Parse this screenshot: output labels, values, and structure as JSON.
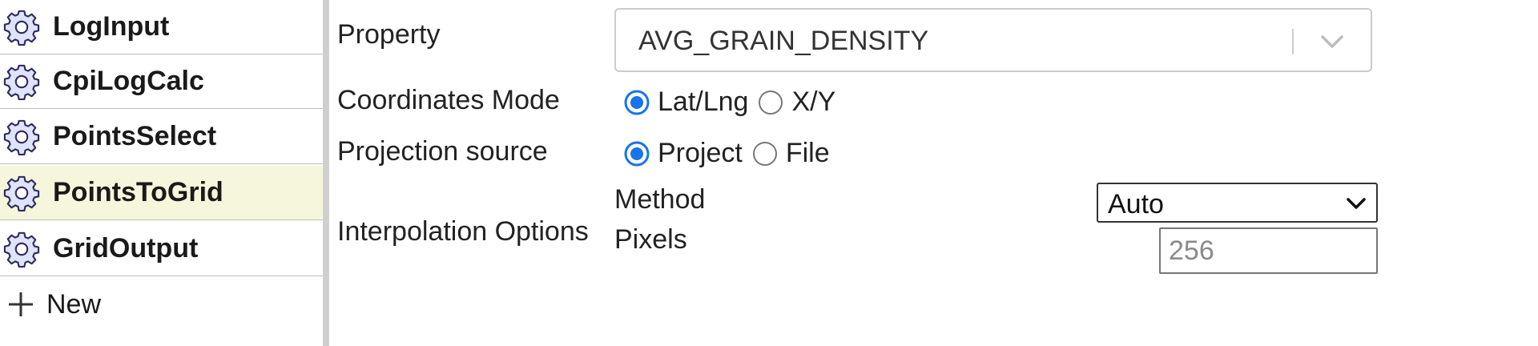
{
  "sidebar": {
    "steps": [
      {
        "label": "LogInput",
        "icon": "gear-icon",
        "active": false
      },
      {
        "label": "CpiLogCalc",
        "icon": "gear-icon",
        "active": false
      },
      {
        "label": "PointsSelect",
        "icon": "gear-icon",
        "active": false
      },
      {
        "label": "PointsToGrid",
        "icon": "gear-icon",
        "active": true
      },
      {
        "label": "GridOutput",
        "icon": "gear-icon",
        "active": false
      }
    ],
    "new_item": {
      "label": "New",
      "icon": "plus-icon"
    },
    "active_background": "#f6f6dc"
  },
  "form": {
    "property": {
      "label": "Property",
      "selected_value": "AVG_GRAIN_DENSITY",
      "icon": "chevron-down-icon"
    },
    "coordinates_mode": {
      "label": "Coordinates Mode",
      "options": [
        {
          "label": "Lat/Lng",
          "checked": true
        },
        {
          "label": "X/Y",
          "checked": false
        }
      ]
    },
    "projection_source": {
      "label": "Projection source",
      "options": [
        {
          "label": "Project",
          "checked": true
        },
        {
          "label": "File",
          "checked": false
        }
      ]
    },
    "interpolation": {
      "label": "Interpolation Options",
      "method": {
        "label": "Method",
        "selected_value": "Auto",
        "icon": "chevron-down-icon"
      },
      "pixels": {
        "label": "Pixels",
        "value": "",
        "placeholder": "256"
      }
    }
  },
  "colors": {
    "radio_checked": "#1a73e8",
    "splitter": "#cfcfcf"
  }
}
